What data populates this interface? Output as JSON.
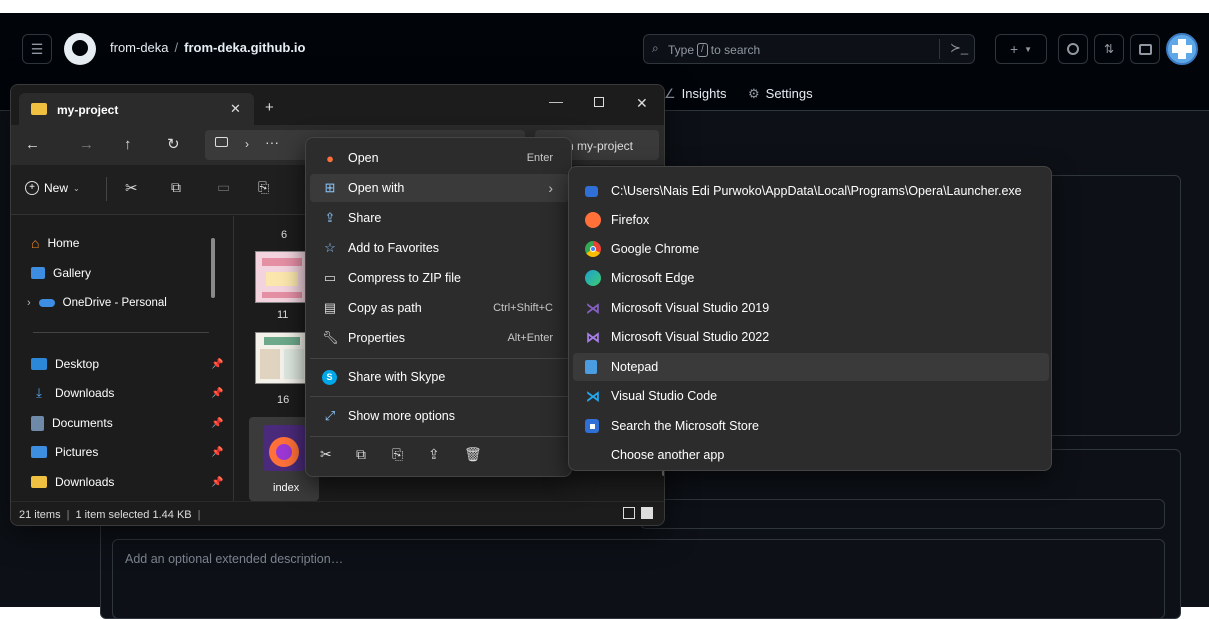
{
  "github": {
    "owner": "from-deka",
    "separator": "/",
    "repo": "from-deka.github.io",
    "search_placeholder": "Type",
    "search_key": "/",
    "search_suffix": "to search",
    "tabs": [
      {
        "label": "Insights"
      },
      {
        "label": "Settings"
      }
    ],
    "description_placeholder": "Add an optional extended description…"
  },
  "explorer": {
    "tab_title": "my-project",
    "search_text": "ch my-project",
    "new_label": "New",
    "nav": {
      "home": "Home",
      "gallery": "Gallery",
      "onedrive": "OneDrive - Personal",
      "pinned": [
        {
          "label": "Desktop",
          "color": "#2b88d8"
        },
        {
          "label": "Downloads",
          "color": "#2b88d8"
        },
        {
          "label": "Documents",
          "color": "#6e8aa8"
        },
        {
          "label": "Pictures",
          "color": "#3d8ee0"
        },
        {
          "label": "Downloads",
          "color": "#f0c040"
        }
      ]
    },
    "files": {
      "n6": "6",
      "n11": "11",
      "n16": "16",
      "index": "index"
    },
    "status": {
      "items": "21 items",
      "selected": "1 item selected  1.44 KB"
    }
  },
  "context_menu": {
    "items": [
      {
        "label": "Open",
        "shortcut": "Enter",
        "icon": "firefox-icon"
      },
      {
        "label": "Open with",
        "shortcut": "›",
        "icon": "open-with-icon"
      },
      {
        "label": "Share",
        "shortcut": "",
        "icon": "share-icon"
      },
      {
        "label": "Add to Favorites",
        "shortcut": "",
        "icon": "star-icon"
      },
      {
        "label": "Compress to ZIP file",
        "shortcut": "",
        "icon": "zip-icon"
      },
      {
        "label": "Copy as path",
        "shortcut": "Ctrl+Shift+C",
        "icon": "path-icon"
      },
      {
        "label": "Properties",
        "shortcut": "Alt+Enter",
        "icon": "wrench-icon"
      },
      {
        "label": "Share with Skype",
        "shortcut": "",
        "icon": "skype-icon"
      },
      {
        "label": "Show more options",
        "shortcut": "",
        "icon": "more-options-icon"
      }
    ]
  },
  "open_with": {
    "items": [
      {
        "label": "C:\\Users\\Nais Edi Purwoko\\AppData\\Local\\Programs\\Opera\\Launcher.exe",
        "icon": "opera-launcher-icon",
        "color": "#2f6fd6"
      },
      {
        "label": "Firefox",
        "icon": "firefox-icon",
        "color": "#ff7139"
      },
      {
        "label": "Google Chrome",
        "icon": "chrome-icon",
        "color": "#fbbc04"
      },
      {
        "label": "Microsoft Edge",
        "icon": "edge-icon",
        "color": "#1ea1d2"
      },
      {
        "label": "Microsoft Visual Studio 2019",
        "icon": "visual-studio-icon",
        "color": "#865fc5"
      },
      {
        "label": "Microsoft Visual Studio 2022",
        "icon": "visual-studio-icon",
        "color": "#865fc5"
      },
      {
        "label": "Notepad",
        "icon": "notepad-icon",
        "color": "#4a9de0"
      },
      {
        "label": "Visual Studio Code",
        "icon": "vscode-icon",
        "color": "#23a9f2"
      },
      {
        "label": "Search the Microsoft Store",
        "icon": "store-icon",
        "color": "#2f6fd6"
      },
      {
        "label": "Choose another app",
        "icon": "",
        "color": ""
      }
    ]
  }
}
